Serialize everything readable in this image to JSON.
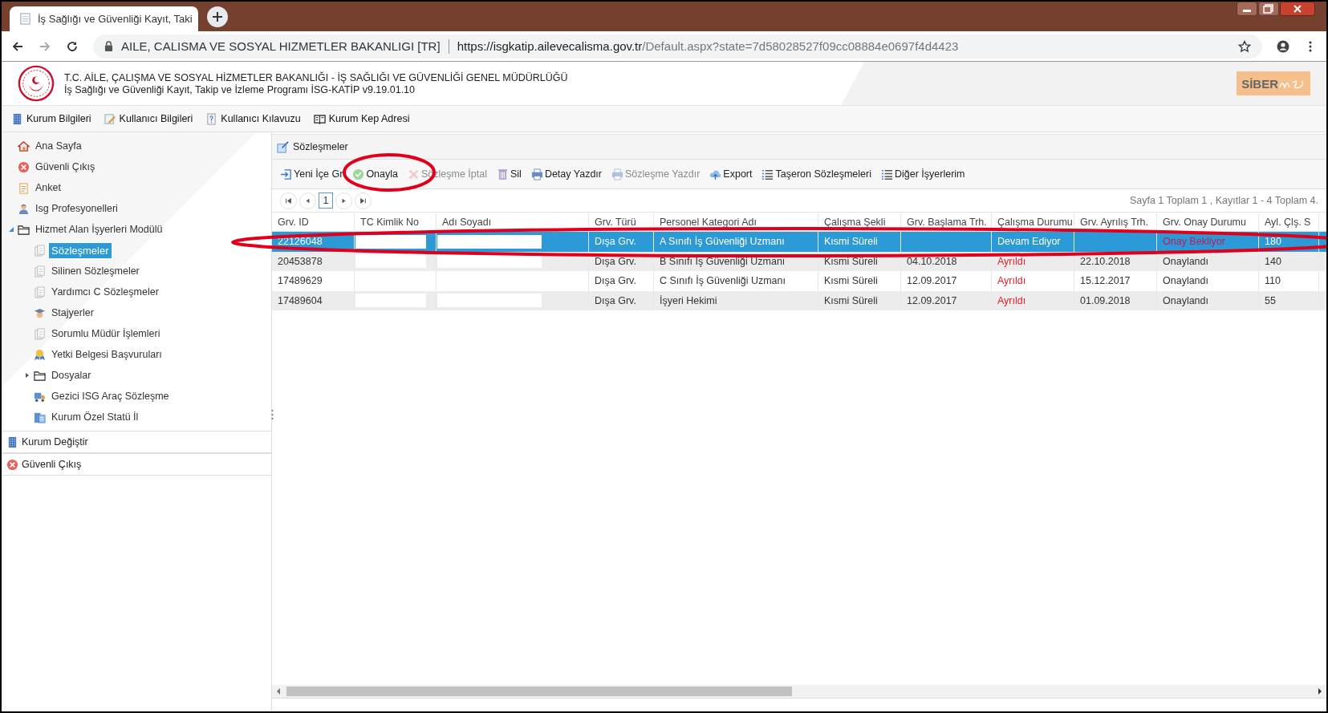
{
  "browser": {
    "tab_title": "İş Sağlığı ve Güvenliği Kayıt, Taki",
    "site_name": "AILE, CALISMA VE SOSYAL HIZMETLER BAKANLIGI [TR]",
    "url_host": "https://isgkatip.ailevecalisma.gov.tr",
    "url_path": "/Default.aspx?state=7d58028527f09cc08884e0697f4d4423"
  },
  "header": {
    "title": "T.C. AİLE, ÇALIŞMA VE SOSYAL HİZMETLER BAKANLIĞI - İŞ SAĞLIĞI VE GÜVENLİĞİ GENEL MÜDÜRLÜĞÜ",
    "subtitle": "İş Sağlığı ve Güvenliği Kayıt, Takip ve İzleme Programı İSG-KATİP v9.19.01.10",
    "brand": "SİBER"
  },
  "menu": [
    {
      "label": "Kurum Bilgileri",
      "kind": "building"
    },
    {
      "label": "Kullanıcı Bilgileri",
      "kind": "edit"
    },
    {
      "label": "Kullanıcı Kılavuzu",
      "kind": "help"
    },
    {
      "label": "Kurum Kep Adresi",
      "kind": "book"
    }
  ],
  "sidebar": {
    "items": [
      {
        "label": "Ana Sayfa",
        "kind": "home",
        "selected": false
      },
      {
        "label": "Güvenli Çıkış",
        "kind": "exit",
        "selected": false
      },
      {
        "label": "Anket",
        "kind": "clipboard",
        "selected": false
      },
      {
        "label": "Isg Profesyonelleri",
        "kind": "person",
        "selected": false
      },
      {
        "label": "Hizmet Alan İşyerleri Modülü",
        "kind": "folder",
        "selected": false,
        "expanded": true,
        "children": [
          {
            "label": "Sözleşmeler",
            "kind": "doc",
            "selected": true
          },
          {
            "label": "Silinen Sözleşmeler",
            "kind": "doc",
            "selected": false
          },
          {
            "label": "Yardımcı C Sözleşmeler",
            "kind": "doc",
            "selected": false
          },
          {
            "label": "Stajyerler",
            "kind": "cap",
            "selected": false
          },
          {
            "label": "Sorumlu Müdür İşlemleri",
            "kind": "doc",
            "selected": false
          },
          {
            "label": "Yetki Belgesi Başvuruları",
            "kind": "award",
            "selected": false
          },
          {
            "label": "Dosyalar",
            "kind": "folder",
            "selected": false,
            "expanded": false
          },
          {
            "label": "Gezici ISG Araç Sözleşme",
            "kind": "truck",
            "selected": false
          },
          {
            "label": "Kurum Özel Statü İl",
            "kind": "building2",
            "selected": false
          }
        ]
      }
    ],
    "footer_items": [
      {
        "label": "Kurum Değiştir",
        "kind": "building"
      },
      {
        "label": "Güvenli Çıkış",
        "kind": "exit"
      }
    ]
  },
  "panel": {
    "title": "Sözleşmeler",
    "toolbar": [
      {
        "label": "Yeni İçe Gr",
        "kind": "enter",
        "disabled": false
      },
      {
        "label": "Onayla",
        "kind": "check",
        "disabled": false
      },
      {
        "label": "Sözleşme İptal",
        "kind": "cancel",
        "disabled": true
      },
      {
        "label": "Sil",
        "kind": "trash",
        "disabled": false
      },
      {
        "label": "Detay Yazdır",
        "kind": "printer",
        "disabled": false
      },
      {
        "label": "Sözleşme Yazdır",
        "kind": "printer",
        "disabled": true
      },
      {
        "label": "Export",
        "kind": "cloud",
        "disabled": false
      },
      {
        "label": "Taşeron Sözleşmeleri",
        "kind": "list",
        "disabled": false
      },
      {
        "label": "Diğer İşyerlerim",
        "kind": "list",
        "disabled": false
      }
    ],
    "pager": {
      "page": "1",
      "summary": "Sayfa 1 Toplam 1 , Kayıtlar 1 - 4 Toplam 4."
    },
    "table": {
      "columns": [
        "Grv. ID",
        "TC Kimlik No",
        "Adı Soyadı",
        "Grv. Türü",
        "Personel Kategori Adı",
        "Çalışma Şekli",
        "Grv. Başlama Trh.",
        "Çalışma Durumu",
        "Grv. Ayrılış Trh.",
        "Grv. Onay Durumu",
        "Ayl. Çlş. S"
      ],
      "rows": [
        {
          "selected": true,
          "cells": [
            {
              "text": "22126048"
            },
            {
              "kind": "redacted"
            },
            {
              "kind": "redacted"
            },
            {
              "text": "Dışa Grv."
            },
            {
              "text": "A Sınıfı İş Güvenliği Uzmanı"
            },
            {
              "text": "Kısmi Süreli"
            },
            {
              "kind": "empty"
            },
            {
              "text": "Devam Ediyor"
            },
            {
              "kind": "empty"
            },
            {
              "text": "Onay Bekliyor",
              "alert": true
            },
            {
              "text": "180"
            }
          ]
        },
        {
          "selected": false,
          "cells": [
            {
              "text": "20453878"
            },
            {
              "kind": "redacted"
            },
            {
              "kind": "redacted"
            },
            {
              "text": "Dışa Grv."
            },
            {
              "text": "B Sınıfı İş Güvenliği Uzmanı"
            },
            {
              "text": "Kısmi Süreli"
            },
            {
              "text": "04.10.2018"
            },
            {
              "text": "Ayrıldı",
              "alert": true
            },
            {
              "text": "22.10.2018"
            },
            {
              "text": "Onaylandı",
              "alert": false
            },
            {
              "text": "140"
            }
          ]
        },
        {
          "selected": false,
          "cells": [
            {
              "text": "17489629"
            },
            {
              "kind": "redacted"
            },
            {
              "kind": "redacted"
            },
            {
              "text": "Dışa Grv."
            },
            {
              "text": "C Sınıfı İş Güvenliği Uzmanı"
            },
            {
              "text": "Kısmi Süreli"
            },
            {
              "text": "12.09.2017"
            },
            {
              "text": "Ayrıldı",
              "alert": true
            },
            {
              "text": "15.12.2017"
            },
            {
              "text": "Onaylandı",
              "alert": false
            },
            {
              "text": "110"
            }
          ]
        },
        {
          "selected": false,
          "cells": [
            {
              "text": "17489604"
            },
            {
              "kind": "redacted"
            },
            {
              "kind": "redacted"
            },
            {
              "text": "Dışa Grv."
            },
            {
              "text": "İşyeri Hekimi"
            },
            {
              "text": "Kısmi Süreli"
            },
            {
              "text": "12.09.2017"
            },
            {
              "text": "Ayrıldı",
              "alert": true
            },
            {
              "text": "01.09.2018"
            },
            {
              "text": "Onaylandı",
              "alert": false
            },
            {
              "text": "55"
            }
          ]
        }
      ]
    }
  }
}
